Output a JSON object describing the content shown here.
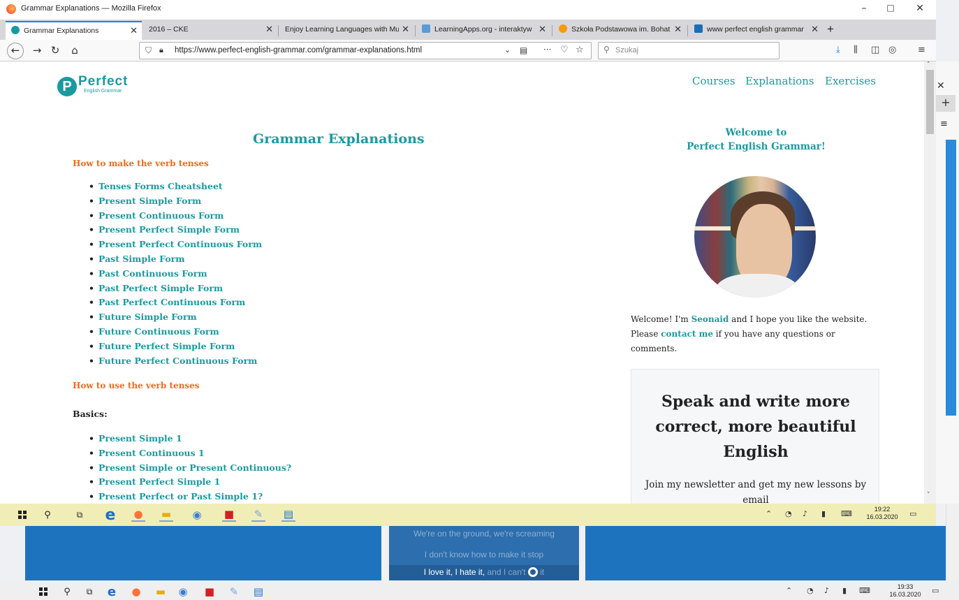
{
  "window": {
    "title": "Grammar Explanations — Mozilla Firefox"
  },
  "tabs": [
    {
      "label": "Grammar Explanations",
      "active": true,
      "favicon_color": "#1a9aa0"
    },
    {
      "label": "2016 – CKE",
      "active": false,
      "favicon_color": ""
    },
    {
      "label": "Enjoy Learning Languages with Mu",
      "active": false,
      "favicon_color": ""
    },
    {
      "label": "LearningApps.org - interaktyw",
      "active": false,
      "favicon_color": "#5a9bd5"
    },
    {
      "label": "Szkoła Podstawowa im. Bohat",
      "active": false,
      "favicon_color": "#f39c12"
    },
    {
      "label": "www perfect english grammar",
      "active": false,
      "favicon_color": "#1a6fb5"
    }
  ],
  "navbar": {
    "url": "https://www.perfect-english-grammar.com/grammar-explanations.html",
    "search_placeholder": "Szukaj"
  },
  "site": {
    "logo_letter": "P",
    "logo_main": "Perfect",
    "logo_sub": "English Grammar",
    "nav": [
      "Courses",
      "Explanations",
      "Exercises"
    ]
  },
  "main": {
    "title": "Grammar Explanations",
    "section1_heading": "How to make the verb tenses",
    "forms": [
      "Tenses Forms Cheatsheet",
      "Present Simple Form",
      "Present Continuous Form",
      "Present Perfect Simple Form",
      "Present Perfect Continuous Form",
      "Past Simple Form",
      "Past Continuous Form",
      "Past Perfect Simple Form",
      "Past Perfect Continuous Form",
      "Future Simple Form",
      "Future Continuous Form",
      "Future Perfect Simple Form",
      "Future Perfect Continuous Form"
    ],
    "section2_heading": "How to use the verb tenses",
    "basics_label": "Basics:",
    "basics": [
      "Present Simple 1",
      "Present Continuous 1",
      "Present Simple or Present Continuous?",
      "Present Perfect Simple 1",
      "Present Perfect or Past Simple 1?"
    ]
  },
  "sidebar": {
    "welcome_line1": "Welcome to",
    "welcome_line2": "Perfect English Grammar!",
    "intro_a": "Welcome! I'm ",
    "intro_name": "Seonaid",
    "intro_b": " and I hope you like the website. Please ",
    "intro_contact": "contact me",
    "intro_c": " if you have any questions or comments.",
    "newsletter_title": "Speak and write more correct, more beautiful English",
    "newsletter_text": "Join my newsletter and get my new lessons by email"
  },
  "taskbar_top": {
    "time": "19:22",
    "date": "16.03.2020"
  },
  "taskbar_bottom": {
    "time": "19:33",
    "date": "16.03.2020"
  },
  "lyrics": {
    "line1": "We're on the ground, we're screaming",
    "line2": "I don't know how to make it stop",
    "line3_a": "I love it, I hate it,",
    "line3_b": " and I can't",
    "line3_c": " it"
  }
}
